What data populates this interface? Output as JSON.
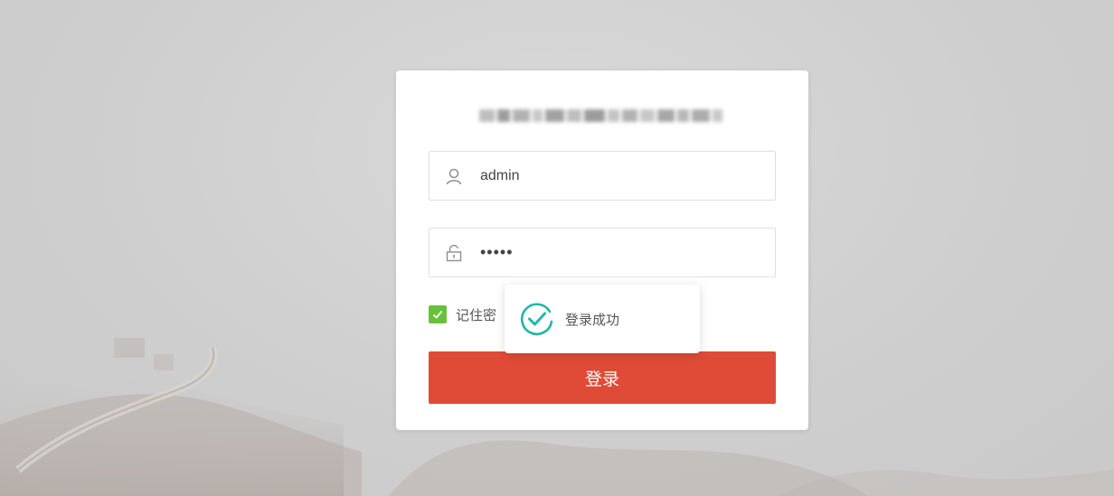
{
  "login": {
    "username": "admin",
    "password": "•••••",
    "remember_label": "记住密",
    "remember_checked": true,
    "submit_label": "登录"
  },
  "toast": {
    "message": "登录成功"
  },
  "icons": {
    "username": "user-icon",
    "password": "lock-icon",
    "checkbox": "checkmark-icon",
    "toast": "success-check-icon"
  },
  "colors": {
    "button": "#df4b37",
    "checkbox": "#67c23a",
    "success": "#23b7a5"
  }
}
